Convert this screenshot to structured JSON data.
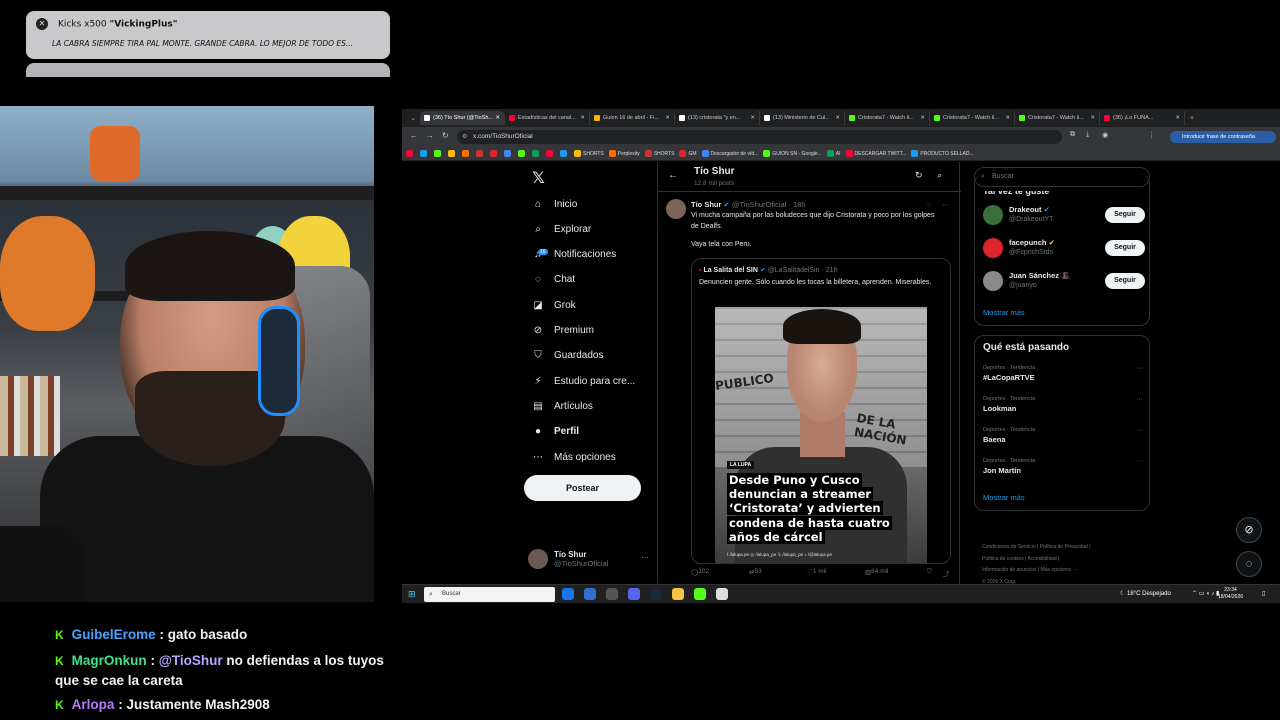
{
  "notification": {
    "title_prefix": "Kicks x500",
    "title_user": "\"VickingPlus\"",
    "message": "LA CABRA SIEMPRE TIRA PAL MONTE. GRANDE CABRA. LO MEJOR DE TODO ES..."
  },
  "chat": [
    {
      "user": "GuibelErome",
      "sep": " : ",
      "text": "gato basado"
    },
    {
      "user": "MagrOnkun",
      "sep": " : ",
      "mention": "@TioShur",
      "text": " no defiendas a los tuyos que se cae la careta"
    },
    {
      "user": "Arlopa",
      "sep": " : ",
      "text": "Justamente Mash2908"
    }
  ],
  "browser": {
    "tabs": [
      {
        "label": "(36) Tío Shur (@TioSh...",
        "color": "#ffffff"
      },
      {
        "label": "Estadísticas del canal...",
        "color": "#ff0033"
      },
      {
        "label": "Guion 16 de abril - Fi...",
        "color": "#f4b400"
      },
      {
        "label": "(13) cristorata \"y en...",
        "color": "#ffffff"
      },
      {
        "label": "(13) Ministerio de Cul...",
        "color": "#ffffff"
      },
      {
        "label": "Cristorata7 - Watch li...",
        "color": "#53fc18"
      },
      {
        "label": "Cristorata7 - Watch li...",
        "color": "#53fc18"
      },
      {
        "label": "Cristorata7 - Watch li...",
        "color": "#53fc18"
      },
      {
        "label": "(36) ¡Lo FUNA...",
        "color": "#ff0033"
      }
    ],
    "url": "x.com/TioShurOficial",
    "password_button": "Introducir frase de contraseña",
    "bookmarks": [
      "SHORTS",
      "Perplexity",
      "SHORTS",
      "GM",
      "Descargador de víd...",
      "GUION SN - Google...",
      "AI",
      "DESCARGAR TWITT...",
      "PRODUCTO SELLAD..."
    ]
  },
  "x": {
    "nav": [
      {
        "icon": "home-icon",
        "glyph": "⌂",
        "label": "Inicio",
        "bold": false
      },
      {
        "icon": "explore-icon",
        "glyph": "⌕",
        "label": "Explorar",
        "bold": false
      },
      {
        "icon": "bell-icon",
        "glyph": "♫",
        "label": "Notificaciones",
        "bold": false,
        "badge": "16"
      },
      {
        "icon": "chat-icon",
        "glyph": "◌",
        "label": "Chat",
        "bold": false
      },
      {
        "icon": "grok-icon",
        "glyph": "◪",
        "label": "Grok",
        "bold": false
      },
      {
        "icon": "premium-icon",
        "glyph": "⊘",
        "label": "Premium",
        "bold": false
      },
      {
        "icon": "bookmark-icon",
        "glyph": "⛉",
        "label": "Guardados",
        "bold": false
      },
      {
        "icon": "studio-icon",
        "glyph": "⚡",
        "label": "Estudio para cre...",
        "bold": false
      },
      {
        "icon": "article-icon",
        "glyph": "▤",
        "label": "Artículos",
        "bold": false
      },
      {
        "icon": "profile-icon",
        "glyph": "●",
        "label": "Perfil",
        "bold": true
      },
      {
        "icon": "more-icon",
        "glyph": "⋯",
        "label": "Más opciones",
        "bold": false
      }
    ],
    "post_button": "Postear",
    "account": {
      "name": "Tío Shur",
      "handle": "@TioShurOficial"
    },
    "header": {
      "name": "Tío Shur",
      "posts": "12,8 mil posts"
    },
    "tweet": {
      "name": "Tío Shur",
      "handle": "@TioShurOficial",
      "time": "· 18h",
      "text": "Vi mucha campaña por las boludeces que dijo Cristorata y poco por los golpes de Dealfs.",
      "text2": "Vaya tela con Peru.",
      "quote": {
        "name": "La Salita del SIN",
        "handle": "@LaSalitadelSin",
        "time": "· 21h",
        "text": "Denuncien gente. Sólo cuando les tocas la billetera, aprenden. Miserables.",
        "image_tag": "LA LUPA",
        "headline": [
          "Desde Puno y Cusco",
          "denuncian a streamer",
          "‘Cristorata’ y advierten",
          "condena de hasta cuatro",
          "años de cárcel"
        ],
        "sign1": "PUBLICO",
        "sign2": "DE LA NACIÓN",
        "social": "f /lalupa.pe   ◎ /lalupa_pe   𝕏 /lalupa_pe   ♪ /@lalupa.pe"
      },
      "actions": {
        "replies": "102",
        "reposts": "53",
        "likes": "1 mil",
        "views": "84 mil"
      }
    },
    "search_placeholder": "Buscar",
    "who_to_follow": {
      "title": "Tal vez te guste",
      "accounts": [
        {
          "name": "Drakeout",
          "handle": "@DrakeoutYT",
          "button": "Seguir",
          "color": "#3a6e3a"
        },
        {
          "name": "facepunch",
          "handle": "@FcpnchStds",
          "button": "Seguir",
          "color": "#e0242c"
        },
        {
          "name": "Juan Sánchez 🎩",
          "handle": "@juanyo",
          "button": "Seguir",
          "color": "#8a8a8a"
        }
      ],
      "more": "Mostrar más"
    },
    "trends": {
      "title": "Qué está pasando",
      "items": [
        {
          "category": "Deportes · Tendencia",
          "topic": "#LaCopaRTVE"
        },
        {
          "category": "Deportes · Tendencia",
          "topic": "Lookman"
        },
        {
          "category": "Deportes · Tendencia",
          "topic": "Baena"
        },
        {
          "category": "Deportes · Tendencia",
          "topic": "Jon Martín"
        }
      ],
      "more": "Mostrar más"
    },
    "footer": [
      "Condiciones de Servicio  |  Política de Privacidad  |",
      "Política de cookies  |  Accesibilidad  |",
      "Información de anuncios  |  Más opciones ···",
      "© 2026 X Corp."
    ]
  },
  "taskbar": {
    "search": "Buscar",
    "weather": "18°C  Despejado",
    "time": "23:34",
    "date": "18/04/2026"
  }
}
